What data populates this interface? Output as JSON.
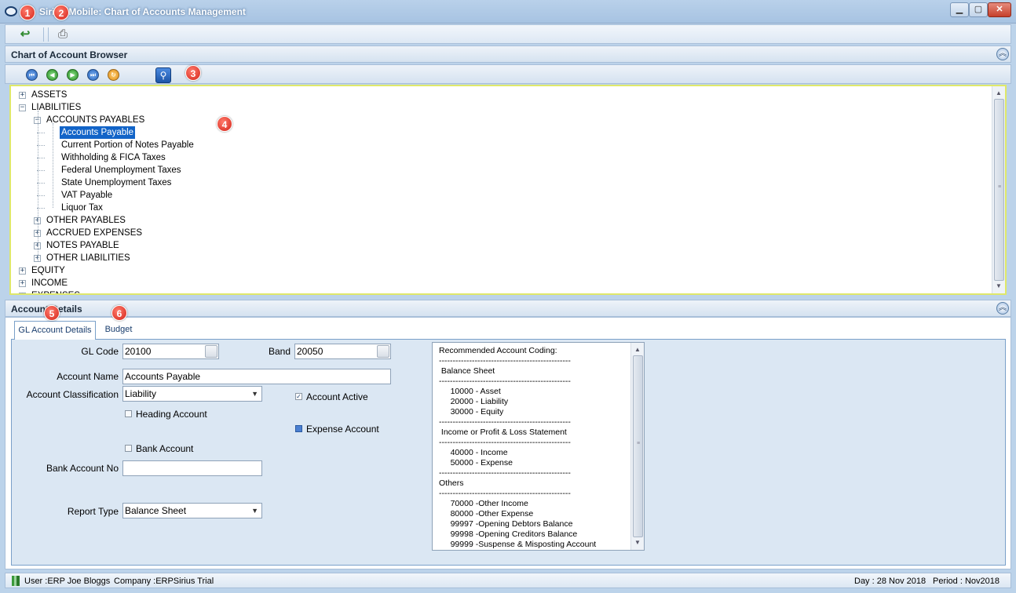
{
  "window": {
    "title": "Sirius-Mobile: Chart of Accounts Management",
    "min_icon": "minimize-icon",
    "max_icon": "maximize-icon",
    "close_icon": "close-icon"
  },
  "toolbar": {
    "buttons": [
      {
        "name": "return-icon",
        "glyph": "↩"
      },
      {
        "name": "print-icon",
        "glyph": "🖶"
      }
    ]
  },
  "browser": {
    "title": "Chart of Account Browser",
    "nav_buttons": [
      "first-icon",
      "previous-icon",
      "next-icon",
      "last-icon",
      "refresh-icon",
      "search-icon"
    ]
  },
  "badges": [
    "1",
    "2",
    "3",
    "4",
    "5",
    "6"
  ],
  "tree": {
    "nodes": [
      {
        "label": "ASSETS",
        "level": 0,
        "toggle": "+"
      },
      {
        "label": "LIABILITIES",
        "level": 0,
        "toggle": "-"
      },
      {
        "label": "ACCOUNTS PAYABLES",
        "level": 1,
        "toggle": "-"
      },
      {
        "label": "Accounts Payable",
        "level": 2,
        "toggle": "",
        "selected": true
      },
      {
        "label": "Current Portion of Notes Payable",
        "level": 2,
        "toggle": ""
      },
      {
        "label": "Withholding & FICA Taxes",
        "level": 2,
        "toggle": ""
      },
      {
        "label": "Federal Unemployment Taxes",
        "level": 2,
        "toggle": ""
      },
      {
        "label": "State Unemployment Taxes",
        "level": 2,
        "toggle": ""
      },
      {
        "label": "VAT Payable",
        "level": 2,
        "toggle": ""
      },
      {
        "label": "Liquor Tax",
        "level": 2,
        "toggle": ""
      },
      {
        "label": "OTHER PAYABLES",
        "level": 1,
        "toggle": "+"
      },
      {
        "label": "ACCRUED EXPENSES",
        "level": 1,
        "toggle": "+"
      },
      {
        "label": "NOTES PAYABLE",
        "level": 1,
        "toggle": "+"
      },
      {
        "label": "OTHER LIABILITIES",
        "level": 1,
        "toggle": "+"
      },
      {
        "label": "EQUITY",
        "level": 0,
        "toggle": "+"
      },
      {
        "label": "INCOME",
        "level": 0,
        "toggle": "+"
      },
      {
        "label": "EXPENSES",
        "level": 0,
        "toggle": "+"
      }
    ]
  },
  "details": {
    "title": "Account Details",
    "tabs": [
      {
        "label": "GL Account Details",
        "active": true
      },
      {
        "label": "Budget",
        "active": false
      }
    ],
    "gl_code_label": "GL Code",
    "gl_code": "20100",
    "band_label": "Band",
    "band": "20050",
    "account_name_label": "Account Name",
    "account_name": "Accounts Payable",
    "classification_label": "Account Classification",
    "classification": "Liability",
    "heading_account_label": "Heading Account",
    "heading_account": false,
    "account_active_label": "Account Active",
    "account_active": true,
    "expense_account_label": "Expense Account",
    "expense_account": true,
    "bank_account_label": "Bank Account",
    "bank_account": false,
    "bank_account_no_label": "Bank Account No",
    "bank_account_no": "",
    "report_type_label": "Report Type",
    "report_type": "Balance Sheet"
  },
  "coding": {
    "lines": [
      "Recommended Account Coding:",
      "------------------------------------------------",
      " Balance Sheet",
      "------------------------------------------------",
      "     10000 - Asset",
      "     20000 - Liability",
      "     30000 - Equity",
      "------------------------------------------------",
      " Income or Profit & Loss Statement",
      "------------------------------------------------",
      "     40000 - Income",
      "     50000 - Expense",
      "------------------------------------------------",
      "Others",
      "------------------------------------------------",
      "     70000 -Other Income",
      "     80000 -Other Expense",
      "     99997 -Opening Debtors Balance",
      "     99998 -Opening Creditors Balance",
      "     99999 -Suspense & Misposting Account"
    ]
  },
  "status": {
    "user": "User :ERP Joe Bloggs",
    "company": "Company :ERPSirius Trial",
    "day": "Day : 28 Nov 2018",
    "period": "Period : Nov2018"
  }
}
